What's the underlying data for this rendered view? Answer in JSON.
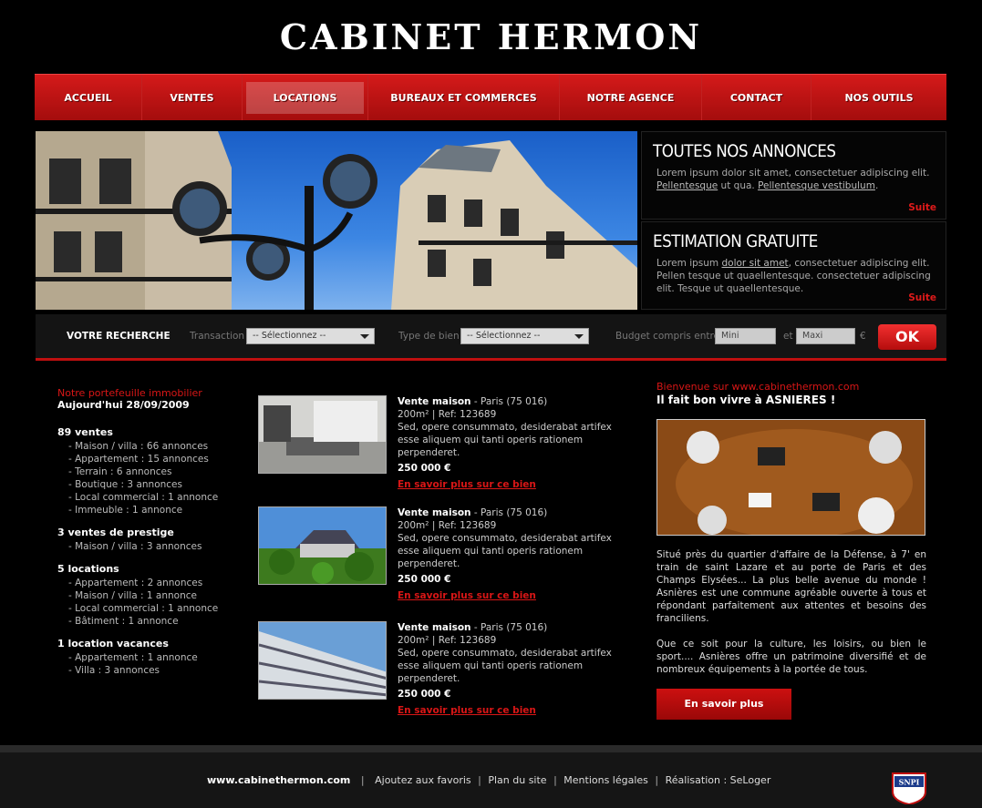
{
  "logo": "CABINET HERMON",
  "nav": [
    "ACCUEIL",
    "VENTES",
    "LOCATIONS",
    "BUREAUX ET COMMERCES",
    "NOTRE AGENCE",
    "CONTACT",
    "NOS OUTILS"
  ],
  "box1": {
    "title": "TOUTES NOS ANNONCES",
    "text": "Lorem ipsum dolor sit amet, consectetuer adipiscing elit.",
    "link1": "Pellentesque",
    "mid": "ut qua.",
    "link2": "Pellentesque vestibulum",
    "suite": "Suite"
  },
  "box2": {
    "title": "ESTIMATION GRATUITE",
    "pre": "Lorem ipsum",
    "link": "dolor sit amet",
    "text": ", consectetuer adipiscing elit. Pellen tesque ut quaellentesque. consectetuer adipiscing elit. Tesque ut quaellentesque.",
    "suite": "Suite"
  },
  "search": {
    "title": "VOTRE RECHERCHE",
    "transaction_label": "Transaction",
    "transaction_value": "-- Sélectionnez --",
    "type_label": "Type de bien",
    "type_value": "-- Sélectionnez --",
    "budget_label": "Budget compris entre",
    "mini": "Mini",
    "et": "et",
    "maxi": "Maxi",
    "currency": "€",
    "ok": "OK"
  },
  "portfolio": {
    "title": "Notre portefeuille immobilier",
    "date": "Aujourd'hui 28/09/2009",
    "categories": [
      {
        "title": "89  ventes",
        "items": [
          "- Maison / villa : 66 annonces",
          "- Appartement : 15 annonces",
          "- Terrain : 6 annonces",
          "- Boutique : 3 annonces",
          "- Local commercial : 1 annonce",
          "- Immeuble : 1 annonce"
        ]
      },
      {
        "title": "3 ventes de prestige",
        "items": [
          "- Maison / villa : 3 annonces"
        ]
      },
      {
        "title": "5  locations",
        "items": [
          "- Appartement : 2 annonces",
          "- Maison / villa : 1 annonce",
          "- Local commercial : 1 annonce",
          "- Bâtiment : 1 annonce"
        ]
      },
      {
        "title": "1 location vacances",
        "items": [
          "- Appartement : 1 annonce",
          "- Villa : 3 annonces"
        ]
      }
    ]
  },
  "listings": [
    {
      "type": "Vente maison",
      "loc": " - Paris (75 016)",
      "ref": "200m² | Ref: 123689",
      "desc": "Sed, opere consummato, desiderabat artifex esse aliquem qui tanti operis rationem perpenderet.",
      "price": "250 000 €",
      "more": "En savoir plus sur ce bien"
    },
    {
      "type": "Vente maison",
      "loc": " - Paris (75 016)",
      "ref": "200m² | Ref: 123689",
      "desc": "Sed, opere consummato, desiderabat artifex esse aliquem qui tanti operis rationem perpenderet.",
      "price": "250 000 €",
      "more": "En savoir plus sur ce bien"
    },
    {
      "type": "Vente maison",
      "loc": " - Paris (75 016)",
      "ref": "200m² | Ref: 123689",
      "desc": "Sed, opere consummato, desiderabat artifex esse aliquem qui tanti operis rationem perpenderet.",
      "price": "250 000 €",
      "more": "En savoir plus sur ce bien"
    }
  ],
  "welcome": {
    "line1": "Bienvenue sur www.cabinethermon.com",
    "line2": "Il fait bon vivre à ASNIERES !",
    "p1": "Situé près du quartier d'affaire de la Défense, à 7' en train de saint Lazare et au porte de Paris et des Champs Elysées... La plus belle avenue du monde ! Asnières est une commune agréable ouverte à tous et répondant parfaitement aux attentes et besoins des franciliens.",
    "p2": "Que ce soit pour la culture, les loisirs, ou bien le sport.... Asnières offre un patrimoine diversifié et de nombreux équipements à la portée de tous.",
    "button": "En savoir plus"
  },
  "footer": {
    "site": "www.cabinethermon.com",
    "links": [
      "Ajoutez aux favoris",
      "Plan du site",
      "Mentions légales",
      "Réalisation : SeLoger"
    ],
    "badge": "SNPI"
  }
}
